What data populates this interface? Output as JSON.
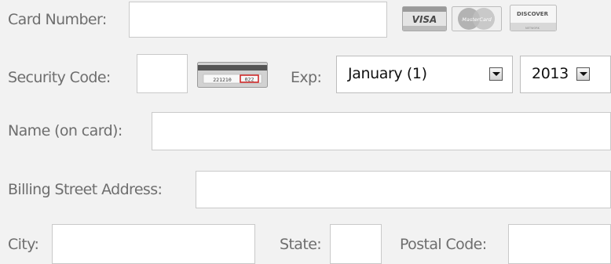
{
  "labels": {
    "card_number": "Card Number:",
    "security_code": "Security Code:",
    "exp": "Exp:",
    "name_on_card": "Name (on card):",
    "billing_street": "Billing Street Address:",
    "city": "City:",
    "state": "State:",
    "postal_code": "Postal Code:"
  },
  "expiration": {
    "month_value": "January (1)",
    "year_value": "2013"
  },
  "card_logos": {
    "visa": "VISA",
    "mastercard": "MasterCard",
    "discover": "DISCOVER",
    "discover_sub": "NETWORK"
  },
  "cvv_illustration": {
    "number_text": "221210",
    "code_text": "022"
  },
  "colors": {
    "background": "#f2f2f2",
    "label_text": "#6e6e6e",
    "field_border": "#c9c9c9",
    "cvv_highlight": "#cc1e1e"
  }
}
